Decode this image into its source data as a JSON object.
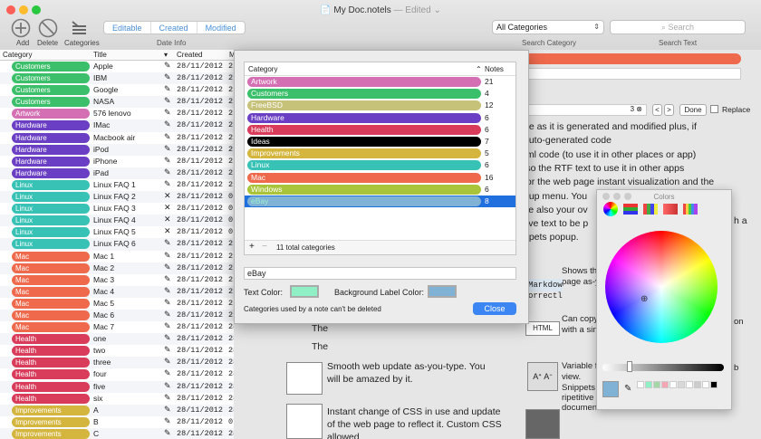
{
  "window": {
    "title": "My Doc.notels",
    "edited": "— Edited ⌄"
  },
  "toolbar": {
    "add_label": "Add",
    "delete_label": "Delete",
    "categories_label": "Categories",
    "filter_tabs": [
      "Editable",
      "Created",
      "Modified"
    ],
    "date_info_label": "Date Info",
    "category_select": "All Categories",
    "search_placeholder": "Search",
    "search_category_label": "Search Category",
    "search_text_label": "Search Text"
  },
  "list": {
    "headers": {
      "category": "Category",
      "title": "Title",
      "created": "Created",
      "modified": "M"
    },
    "rows": [
      {
        "category": "Customers",
        "title": "Apple",
        "icon": "✎",
        "date": "28/11/2012",
        "m": "2",
        "color": "#3cbf6a"
      },
      {
        "category": "Customers",
        "title": "IBM",
        "icon": "✎",
        "date": "28/11/2012",
        "m": "2",
        "color": "#3cbf6a"
      },
      {
        "category": "Customers",
        "title": "Google",
        "icon": "✎",
        "date": "28/11/2012",
        "m": "2",
        "color": "#3cbf6a"
      },
      {
        "category": "Customers",
        "title": "NASA",
        "icon": "✎",
        "date": "28/11/2012",
        "m": "2",
        "color": "#3cbf6a"
      },
      {
        "category": "Artwork",
        "title": "576 lenovo",
        "icon": "✎",
        "date": "28/11/2012",
        "m": "2",
        "color": "#d46fb4"
      },
      {
        "category": "Hardware",
        "title": "IMac",
        "icon": "✎",
        "date": "28/11/2012",
        "m": "2",
        "color": "#6a3fc4"
      },
      {
        "category": "Hardware",
        "title": "Macbook air",
        "icon": "✎",
        "date": "28/11/2012",
        "m": "2",
        "color": "#6a3fc4"
      },
      {
        "category": "Hardware",
        "title": "iPod",
        "icon": "✎",
        "date": "28/11/2012",
        "m": "2",
        "color": "#6a3fc4"
      },
      {
        "category": "Hardware",
        "title": "iPhone",
        "icon": "✎",
        "date": "28/11/2012",
        "m": "2",
        "color": "#6a3fc4"
      },
      {
        "category": "Hardware",
        "title": "iPad",
        "icon": "✎",
        "date": "28/11/2012",
        "m": "2",
        "color": "#6a3fc4"
      },
      {
        "category": "Linux",
        "title": "Linux FAQ 1",
        "icon": "✎",
        "date": "28/11/2012",
        "m": "2",
        "color": "#38c2b5"
      },
      {
        "category": "Linux",
        "title": "Linux FAQ 2",
        "icon": "✕",
        "date": "28/11/2012",
        "m": "0",
        "color": "#38c2b5"
      },
      {
        "category": "Linux",
        "title": "Linux FAQ 3",
        "icon": "✕",
        "date": "28/11/2012",
        "m": "0",
        "color": "#38c2b5"
      },
      {
        "category": "Linux",
        "title": "Linux FAQ 4",
        "icon": "✕",
        "date": "28/11/2012",
        "m": "0",
        "color": "#38c2b5"
      },
      {
        "category": "Linux",
        "title": "Linux FAQ 5",
        "icon": "✕",
        "date": "28/11/2012",
        "m": "0",
        "color": "#38c2b5"
      },
      {
        "category": "Linux",
        "title": "Linux FAQ 6",
        "icon": "✎",
        "date": "28/11/2012",
        "m": "2",
        "color": "#38c2b5"
      },
      {
        "category": "Mac",
        "title": "Mac 1",
        "icon": "✎",
        "date": "28/11/2012",
        "m": "2",
        "color": "#ef6a4d"
      },
      {
        "category": "Mac",
        "title": "Mac 2",
        "icon": "✎",
        "date": "28/11/2012",
        "m": "2",
        "color": "#ef6a4d"
      },
      {
        "category": "Mac",
        "title": "Mac 3",
        "icon": "✎",
        "date": "28/11/2012",
        "m": "2",
        "color": "#ef6a4d"
      },
      {
        "category": "Mac",
        "title": "Mac 4",
        "icon": "✎",
        "date": "28/11/2012",
        "m": "2",
        "color": "#ef6a4d"
      },
      {
        "category": "Mac",
        "title": "Mac 5",
        "icon": "✎",
        "date": "28/11/2012",
        "m": "2",
        "color": "#ef6a4d"
      },
      {
        "category": "Mac",
        "title": "Mac 6",
        "icon": "✎",
        "date": "28/11/2012",
        "m": "2",
        "color": "#ef6a4d"
      },
      {
        "category": "Mac",
        "title": "Mac 7",
        "icon": "✎",
        "date": "28/11/2012",
        "m": "28/11/2012",
        "color": "#ef6a4d"
      },
      {
        "category": "Health",
        "title": "one",
        "icon": "✎",
        "date": "28/11/2012",
        "m": "28/11/2012",
        "color": "#d93c5a"
      },
      {
        "category": "Health",
        "title": "two",
        "icon": "✎",
        "date": "28/11/2012",
        "m": "28/11/2012",
        "color": "#d93c5a"
      },
      {
        "category": "Health",
        "title": "three",
        "icon": "✎",
        "date": "28/11/2012",
        "m": "28/11/2012",
        "color": "#d93c5a"
      },
      {
        "category": "Health",
        "title": "four",
        "icon": "✎",
        "date": "28/11/2012",
        "m": "28/11/2012",
        "color": "#d93c5a"
      },
      {
        "category": "Health",
        "title": "five",
        "icon": "✎",
        "date": "28/11/2012",
        "m": "28/11/2012",
        "color": "#d93c5a"
      },
      {
        "category": "Health",
        "title": "six",
        "icon": "✎",
        "date": "28/11/2012",
        "m": "28/11/2012",
        "color": "#d93c5a"
      },
      {
        "category": "Improvements",
        "title": "A",
        "icon": "✎",
        "date": "28/11/2012",
        "m": "28/11/2012",
        "color": "#d4b53d"
      },
      {
        "category": "Improvements",
        "title": "B",
        "icon": "✎",
        "date": "28/11/2012",
        "m": "07/06/2018",
        "color": "#d4b53d"
      },
      {
        "category": "Improvements",
        "title": "C",
        "icon": "✎",
        "date": "28/11/2012",
        "m": "28/11/2012",
        "color": "#d4b53d"
      }
    ]
  },
  "dialog": {
    "col_category": "Category",
    "col_notes": "Notes",
    "categories": [
      {
        "name": "Artwork",
        "notes": "21",
        "color": "#d46fb4",
        "text_color": "#ffffff"
      },
      {
        "name": "Customers",
        "notes": "4",
        "color": "#3cbf6a",
        "text_color": "#ffffff"
      },
      {
        "name": "FreeBSD",
        "notes": "12",
        "color": "#c7c27a",
        "text_color": "#ffffff"
      },
      {
        "name": "Hardware",
        "notes": "6",
        "color": "#6a3fc4",
        "text_color": "#ffffff"
      },
      {
        "name": "Health",
        "notes": "6",
        "color": "#d93c5a",
        "text_color": "#ffffff"
      },
      {
        "name": "Ideas",
        "notes": "7",
        "color": "#000000",
        "text_color": "#ffffff"
      },
      {
        "name": "Improvements",
        "notes": "5",
        "color": "#d4b53d",
        "text_color": "#ffffff"
      },
      {
        "name": "Linux",
        "notes": "6",
        "color": "#38c2b5",
        "text_color": "#ffffff"
      },
      {
        "name": "Mac",
        "notes": "16",
        "color": "#ef6a4d",
        "text_color": "#ffffff"
      },
      {
        "name": "Windows",
        "notes": "6",
        "color": "#a9c43a",
        "text_color": "#ffffff"
      },
      {
        "name": "eBay",
        "notes": "8",
        "color": "#7fb2d4",
        "text_color": "#9ef0cf"
      }
    ],
    "footer_plus": "+",
    "footer_minus": "−",
    "footer_count": "11 total categories",
    "name_value": "eBay",
    "text_color_label": "Text Color:",
    "bg_color_label": "Background Label Color:",
    "text_color_swatch": "#8ff0c6",
    "bg_color_swatch": "#7fb2d4",
    "note": "Categories used by a note can't be deleted",
    "close_label": "Close"
  },
  "find_bar": {
    "count": "3",
    "done_label": "Done",
    "replace_label": "Replace"
  },
  "editor": {
    "lines": [
      "ge as it is generated and modified plus, if",
      "auto-generated code",
      "tml code (to use it in other places or app)",
      "lso the RTF text to use it in other apps",
      "for the web page instant visualization and the",
      "pup menu. You",
      "se also your ov",
      "tive text to be p",
      "ppets popup."
    ],
    "the1": "The",
    "the2": "The",
    "smooth": "Smooth web update as-you-type. You will be amazed by it.",
    "instant": "Instant change of CSS in use and update of the web page to reflect it. Custom CSS allowed",
    "shows": "Shows th",
    "page_as": "page as-y",
    "markdown": "Markdow",
    "correct": "orrectl",
    "can_copy": "Can copy",
    "with_a": "with a sin",
    "variable": "Variable f",
    "view": "view.",
    "snippets": "Snippets manager to manage portion of ripetitive text, available to paste in any documents.",
    "html_btn": "HTML",
    "ah_label": "h a",
    "on_label": "on",
    "b_label": "b"
  },
  "colors_panel": {
    "title": "Colors",
    "swatches": [
      "#7fb2d4",
      "#ffffff",
      "#8ff0c6",
      "#a5d6a7",
      "#f4a6b4",
      "#ffffff",
      "#d8d8d8",
      "#ffffff",
      "#cccccc",
      "#ffffff",
      "#000000"
    ]
  }
}
